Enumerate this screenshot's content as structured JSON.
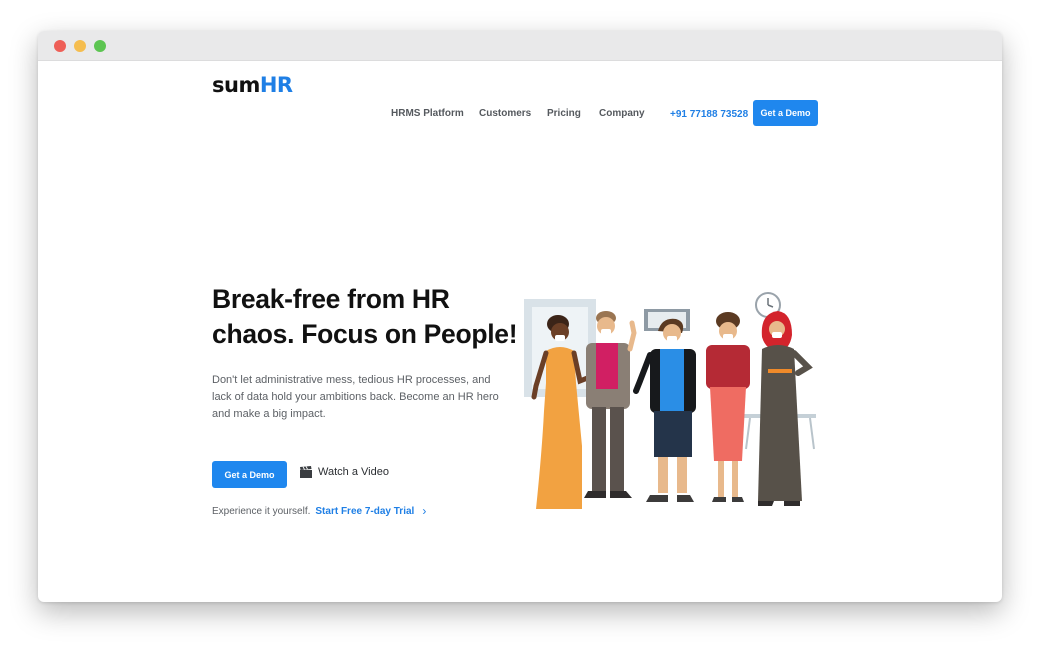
{
  "header": {
    "logo": {
      "part1": "sum",
      "part2": "HR"
    },
    "nav": [
      "HRMS Platform",
      "Customers",
      "Pricing",
      "Company"
    ],
    "phone": "+91 77188 73528",
    "cta_label": "Get a Demo"
  },
  "hero": {
    "title": "Break-free from HR chaos. Focus on People!",
    "subtitle": "Don't let administrative mess, tedious HR processes, and lack of data hold your ambitions back. Become an HR hero and make a big impact.",
    "cta_label": "Get a Demo",
    "watch_label": "Watch a Video",
    "trial_prefix": "Experience it yourself.",
    "trial_link": "Start Free 7-day Trial",
    "trial_chevron": "›"
  },
  "colors": {
    "brand_blue": "#1f87ee",
    "logo_dark": "#111111",
    "logo_blue": "#1f7fe5"
  },
  "icons": [
    "clapperboard-icon",
    "chevron-right-icon"
  ]
}
